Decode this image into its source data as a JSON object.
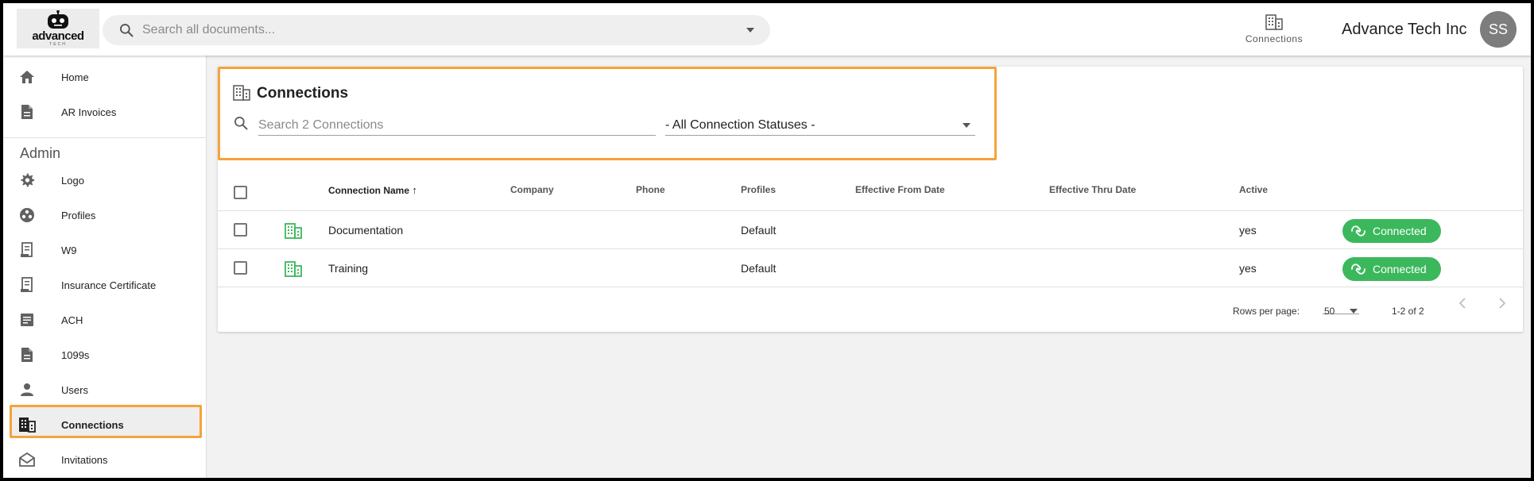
{
  "header": {
    "logo_text": "advanced",
    "logo_sub": "TECH",
    "search_placeholder": "Search all documents...",
    "connections_label": "Connections",
    "org_name": "Advance Tech Inc",
    "avatar_initials": "SS"
  },
  "sidebar": {
    "items": [
      {
        "label": "Home",
        "icon": "home-icon"
      },
      {
        "label": "AR Invoices",
        "icon": "document-icon"
      }
    ],
    "admin_title": "Admin",
    "admin_items": [
      {
        "label": "Logo",
        "icon": "gear-icon"
      },
      {
        "label": "Profiles",
        "icon": "profiles-icon"
      },
      {
        "label": "W9",
        "icon": "receipt-icon"
      },
      {
        "label": "Insurance Certificate",
        "icon": "receipt-icon"
      },
      {
        "label": "ACH",
        "icon": "list-document-icon"
      },
      {
        "label": "1099s",
        "icon": "document-icon"
      },
      {
        "label": "Users",
        "icon": "person-icon"
      },
      {
        "label": "Connections",
        "icon": "building-icon",
        "active": true
      },
      {
        "label": "Invitations",
        "icon": "envelope-icon"
      }
    ]
  },
  "main": {
    "title": "Connections",
    "search_placeholder": "Search 2 Connections",
    "status_filter": "- All Connection Statuses -",
    "columns": [
      "Connection Name",
      "Company",
      "Phone",
      "Profiles",
      "Effective From Date",
      "Effective Thru Date",
      "Active"
    ],
    "rows": [
      {
        "name": "Documentation",
        "company": "",
        "phone": "",
        "profiles": "Default",
        "from": "",
        "thru": "",
        "active": "yes",
        "status": "Connected"
      },
      {
        "name": "Training",
        "company": "",
        "phone": "",
        "profiles": "Default",
        "from": "",
        "thru": "",
        "active": "yes",
        "status": "Connected"
      }
    ],
    "pagination": {
      "rows_per_page_label": "Rows per page:",
      "rows_per_page": "50",
      "range": "1-2 of 2"
    }
  },
  "colors": {
    "accent_highlight": "#f5a33a",
    "connected_green": "#3cb85c",
    "building_green": "#3cb85c"
  }
}
